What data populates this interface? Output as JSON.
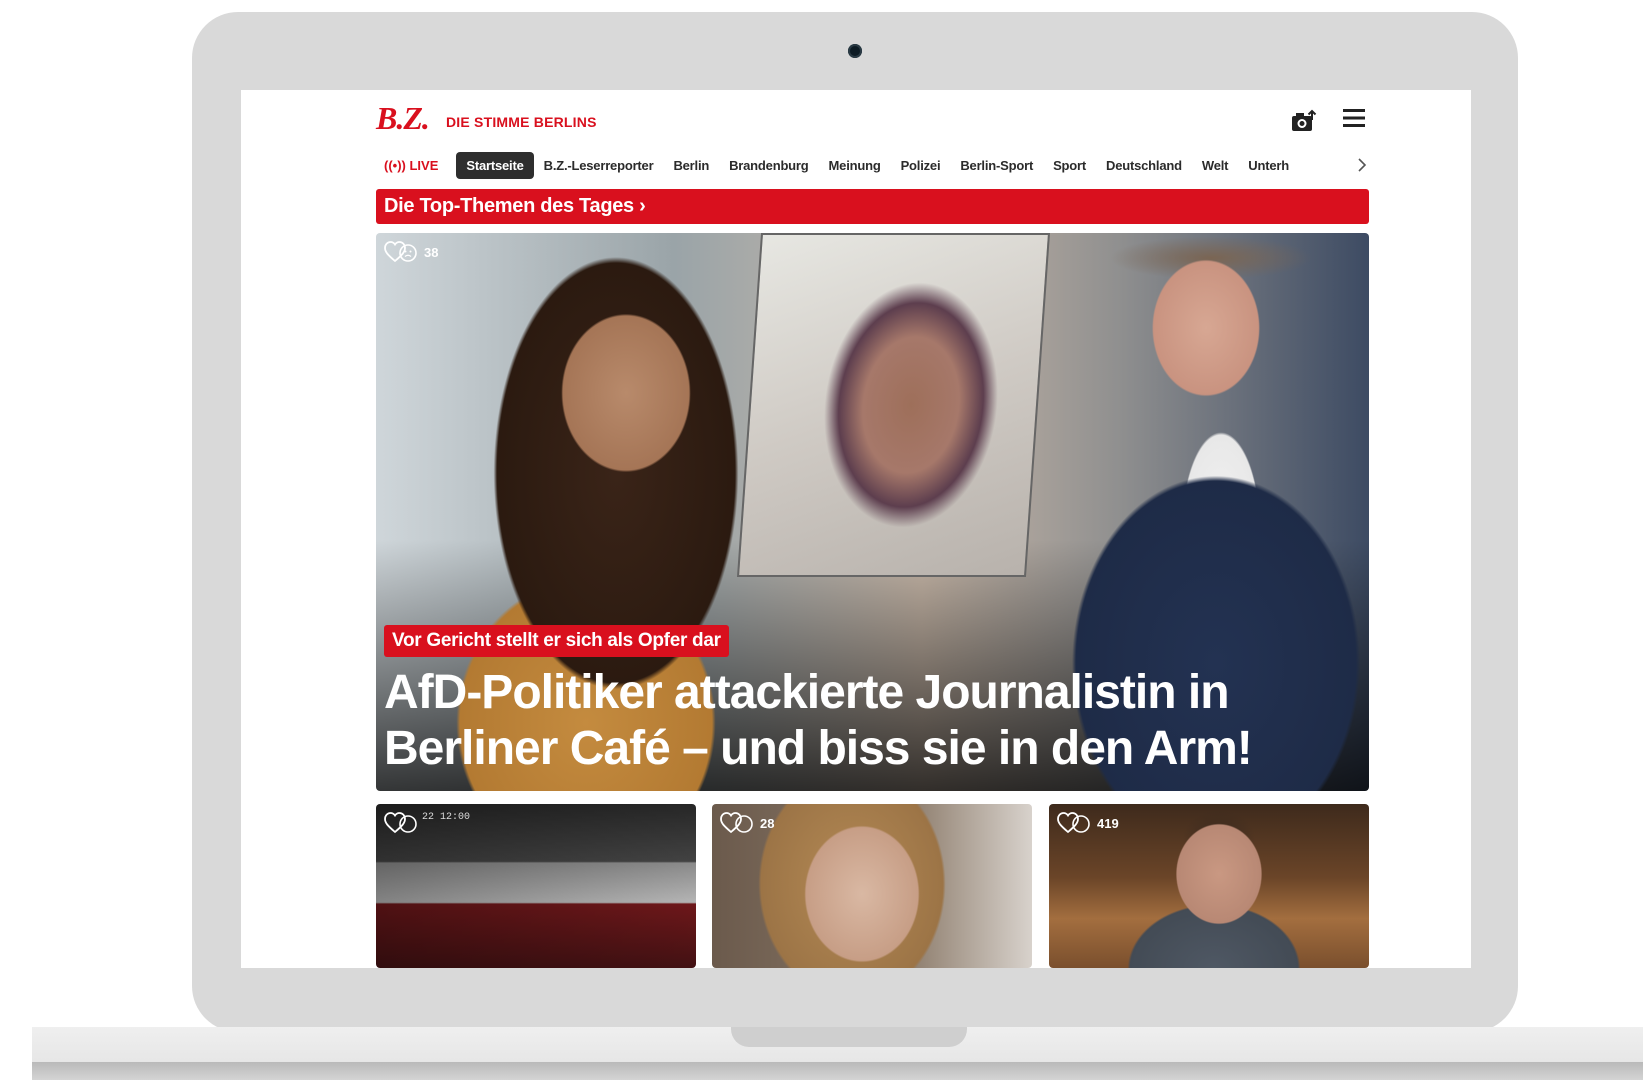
{
  "brand": {
    "logo_mark": "B.Z.",
    "tagline": "DIE STIMME BERLINS",
    "accent": "#d9101e"
  },
  "header": {
    "upload_icon": "camera-upload-icon",
    "menu_icon": "hamburger-menu-icon"
  },
  "nav": {
    "live_label": "((•)) LIVE",
    "items": [
      {
        "label": "Startseite",
        "active": true
      },
      {
        "label": "B.Z.-Leserreporter"
      },
      {
        "label": "Berlin"
      },
      {
        "label": "Brandenburg"
      },
      {
        "label": "Meinung"
      },
      {
        "label": "Polizei"
      },
      {
        "label": "Berlin-Sport"
      },
      {
        "label": "Sport"
      },
      {
        "label": "Deutschland"
      },
      {
        "label": "Welt"
      },
      {
        "label": "Unterh"
      }
    ],
    "next_icon": "chevron-right-icon"
  },
  "top_themes": {
    "label": "Die Top-Themen des Tages ›"
  },
  "hero": {
    "reactions": "38",
    "kicker": "Vor Gericht stellt er sich als Opfer dar",
    "headline_line1": "AfD-Politiker attackierte Journalistin in",
    "headline_line2": "Berliner Café – und biss sie in den Arm!"
  },
  "cards": [
    {
      "reactions": "",
      "timestamp": "22 12:00"
    },
    {
      "reactions": "28"
    },
    {
      "reactions": "419"
    }
  ]
}
